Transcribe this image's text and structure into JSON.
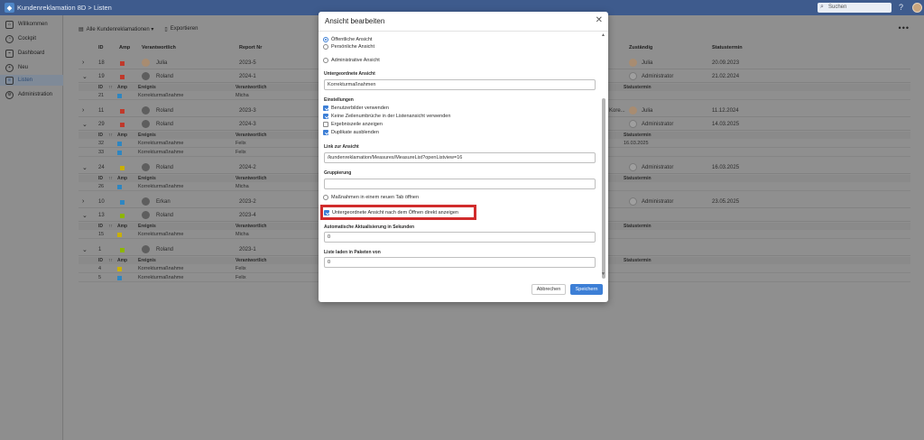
{
  "app": {
    "title": "Kundenreklamation 8D > Listen",
    "search_placeholder": "Suchen",
    "help": "?"
  },
  "sidebar": {
    "items": [
      {
        "label": "Willkommen",
        "icon": "home-icon"
      },
      {
        "label": "Cockpit",
        "icon": "gauge-icon"
      },
      {
        "label": "Dashboard",
        "icon": "chart-icon"
      },
      {
        "label": "Neu",
        "icon": "plus-icon"
      },
      {
        "label": "Listen",
        "icon": "list-icon"
      },
      {
        "label": "Administration",
        "icon": "gear-icon"
      }
    ]
  },
  "toolbar": {
    "view_label": "Alle Kundenreklamationen ▾",
    "export_label": "Exportieren",
    "more": "•••"
  },
  "table": {
    "headers": {
      "id": "ID",
      "amp": "Amp",
      "responsible": "Verantwortlich",
      "report": "Report Nr",
      "assigned": "Zuständig",
      "due": "Statustermin"
    },
    "sub_headers": {
      "id": "ID",
      "sort": "↑↑",
      "amp": "Amp",
      "event": "Ereignis",
      "responsible": "Verantwortlich",
      "due": "Statustermin"
    },
    "groups": [
      {
        "id": "18",
        "amp": "#c0392b",
        "name": "Julia",
        "report": "2023-5",
        "assigned": "Julia",
        "due": "20.09.2023",
        "expanded": false,
        "rows": []
      },
      {
        "id": "19",
        "amp": "#c0392b",
        "name": "Roland",
        "report": "2024-1",
        "assigned": "Administrator",
        "due": "21.02.2024",
        "expanded": true,
        "rows": [
          {
            "id": "21",
            "amp": "#2e86c1",
            "event": "Korrekturmaßnahme",
            "resp": "Micha",
            "due": ""
          }
        ]
      },
      {
        "id": "11",
        "amp": "#c0392b",
        "name": "Roland",
        "report": "2023-3",
        "assigned_prefix": "Kore...",
        "assigned": "Julia",
        "due": "11.12.2024",
        "expanded": false,
        "rows": []
      },
      {
        "id": "29",
        "amp": "#c0392b",
        "name": "Roland",
        "report": "2024-3",
        "assigned": "Administrator",
        "due": "14.03.2025",
        "expanded": true,
        "rows": [
          {
            "id": "32",
            "amp": "#2e86c1",
            "event": "Korrekturmaßnahme",
            "resp": "Felix",
            "due": "16.03.2025"
          },
          {
            "id": "33",
            "amp": "#2e86c1",
            "event": "Korrekturmaßnahme",
            "resp": "Felix",
            "due": ""
          }
        ]
      },
      {
        "id": "24",
        "amp": "#c9b000",
        "name": "Roland",
        "report": "2024-2",
        "assigned": "Administrator",
        "due": "16.03.2025",
        "expanded": true,
        "rows": [
          {
            "id": "26",
            "amp": "#2e86c1",
            "event": "Korrekturmaßnahme",
            "resp": "Micha",
            "due": ""
          }
        ]
      },
      {
        "id": "10",
        "amp": "#2e86c1",
        "name": "Erkan",
        "report": "2023-2",
        "assigned": "Administrator",
        "due": "23.05.2025",
        "expanded": false,
        "rows": []
      },
      {
        "id": "13",
        "amp": "#8db600",
        "name": "Roland",
        "report": "2023-4",
        "assigned": "",
        "due": "",
        "expanded": true,
        "rows": [
          {
            "id": "15",
            "amp": "#c9b000",
            "event": "Korrekturmaßnahme",
            "resp": "Micha",
            "due": ""
          }
        ]
      },
      {
        "id": "1",
        "amp": "#8db600",
        "name": "Roland",
        "report": "2023-1",
        "assigned": "",
        "due": "",
        "expanded": true,
        "rows": [
          {
            "id": "4",
            "amp": "#c9b000",
            "event": "Korrekturmaßnahme",
            "resp": "Felix",
            "due": ""
          },
          {
            "id": "5",
            "amp": "#2e86c1",
            "event": "Korrekturmaßnahme",
            "resp": "Felix",
            "due": ""
          }
        ]
      }
    ]
  },
  "modal": {
    "title": "Ansicht bearbeiten",
    "visibility": {
      "public": "Öffentliche Ansicht",
      "personal": "Persönliche Ansicht",
      "admin": "Administrative Ansicht",
      "selected": "public"
    },
    "sub_view_label": "Untergeordnete Ansicht",
    "sub_view_value": "Korrekturmaßnahmen",
    "settings_label": "Einstellungen",
    "settings": [
      {
        "label": "Benutzerbilder verwenden",
        "checked": true
      },
      {
        "label": "Keine Zeilenumbrüche in der Listenansicht verwenden",
        "checked": true
      },
      {
        "label": "Ergebniszeile anzeigen",
        "checked": false
      },
      {
        "label": "Duplikate ausblenden",
        "checked": true
      }
    ],
    "link_label": "Link zur Ansicht",
    "link_value": "/kundenreklamation/Measures/MeasureList?openListview=16",
    "grouping_label": "Gruppierung",
    "grouping_value": "",
    "open_new_tab": {
      "label": "Maßnahmen in einem neuen Tab öffnen",
      "checked": false
    },
    "show_sub_view": {
      "label": "Untergeordnete Ansicht nach dem Öffnen direkt anzeigen",
      "checked": true
    },
    "auto_refresh_label": "Automatische Aktualisierung in Sekunden",
    "auto_refresh_value": "0",
    "batch_label": "Liste laden in Paketen von",
    "batch_value": "0",
    "cancel": "Abbrechen",
    "save": "Speichern"
  },
  "colors": {
    "accent": "#3d7fd6",
    "highlight": "#d12c2c",
    "topbar": "#3e5b8d"
  }
}
